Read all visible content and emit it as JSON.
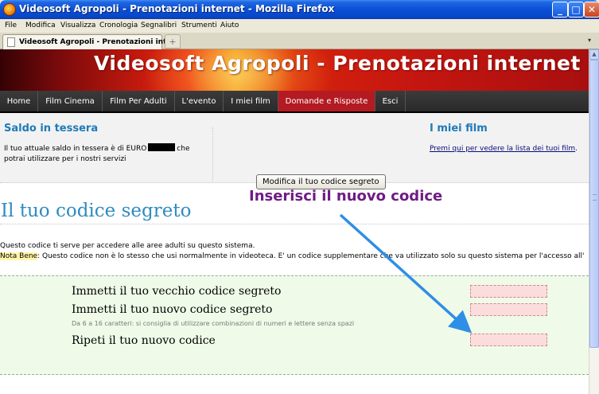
{
  "window": {
    "title": "Videosoft Agropoli - Prenotazioni internet - Mozilla Firefox",
    "min_glyph": "_",
    "max_glyph": "□",
    "close_glyph": "✕"
  },
  "menu": [
    "File",
    "Modifica",
    "Visualizza",
    "Cronologia",
    "Segnalibri",
    "Strumenti",
    "Aiuto"
  ],
  "tabs": {
    "active_label": "Videosoft Agropoli - Prenotazioni int...",
    "new_tab_glyph": "+",
    "list_glyph": "▾"
  },
  "banner": {
    "title": "Videosoft Agropoli - Prenotazioni internet"
  },
  "nav": {
    "items": [
      "Home",
      "Film Cinema",
      "Film Per Adulti",
      "L'evento",
      "I miei film",
      "Domande e Risposte",
      "Esci"
    ],
    "active_index": 5,
    "active_color": "#B41A22"
  },
  "saldo": {
    "title": "Saldo in tessera",
    "text_before": "Il tuo attuale saldo in tessera è di EURO",
    "text_after": "che potrai utilizzare per i nostri servizi"
  },
  "miei_film": {
    "title": "I miei film",
    "link_text": "Premi qui per vedere la lista dei tuoi film",
    "link_suffix": "."
  },
  "annotation": {
    "text": "Inserisci il nuovo codice",
    "color": "#6E1C84"
  },
  "page": {
    "title": "Il tuo codice segreto",
    "desc_line1": "Questo codice ti serve per accedere alle aree adulti su questo sistema.",
    "nota_label": "Nota Bene",
    "desc_line2": ": Questo codice non è lo stesso che usi normalmente in videoteca. E' un codice supplementare che va utilizzato solo su questo sistema per l'accesso all'"
  },
  "form": {
    "old_label": "Immetti il tuo vecchio codice segreto",
    "new_label": "Immetti il tuo nuovo codice segreto",
    "new_hint": "Da 6 a 16 caratteri: si consiglia di utilizzare combinazioni di numeri e lettere senza spazi",
    "repeat_label": "Ripeti il tuo nuovo codice",
    "submit_label": "Modifica il tuo codice segreto"
  },
  "scrollbar": {
    "up_glyph": "▲"
  },
  "colors": {
    "accent_blue": "#1f7ab8",
    "arrow": "#2F8EE6"
  }
}
